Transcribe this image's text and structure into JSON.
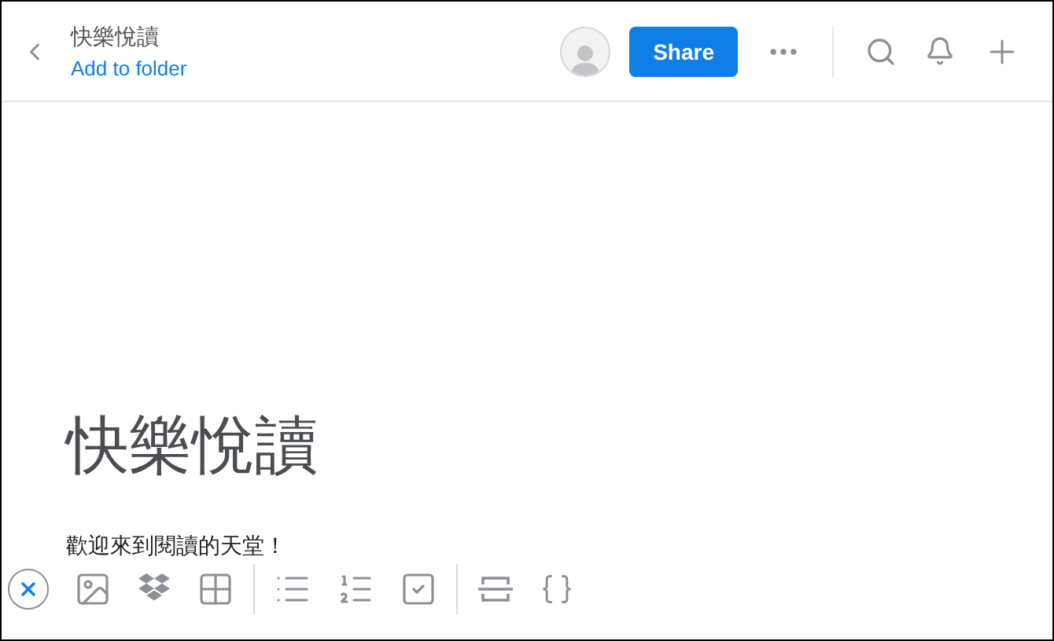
{
  "header": {
    "title": "快樂悅讀",
    "folder_link": "Add to folder",
    "share_button": "Share"
  },
  "document": {
    "title": "快樂悅讀",
    "body": "歡迎來到閱讀的天堂！"
  }
}
